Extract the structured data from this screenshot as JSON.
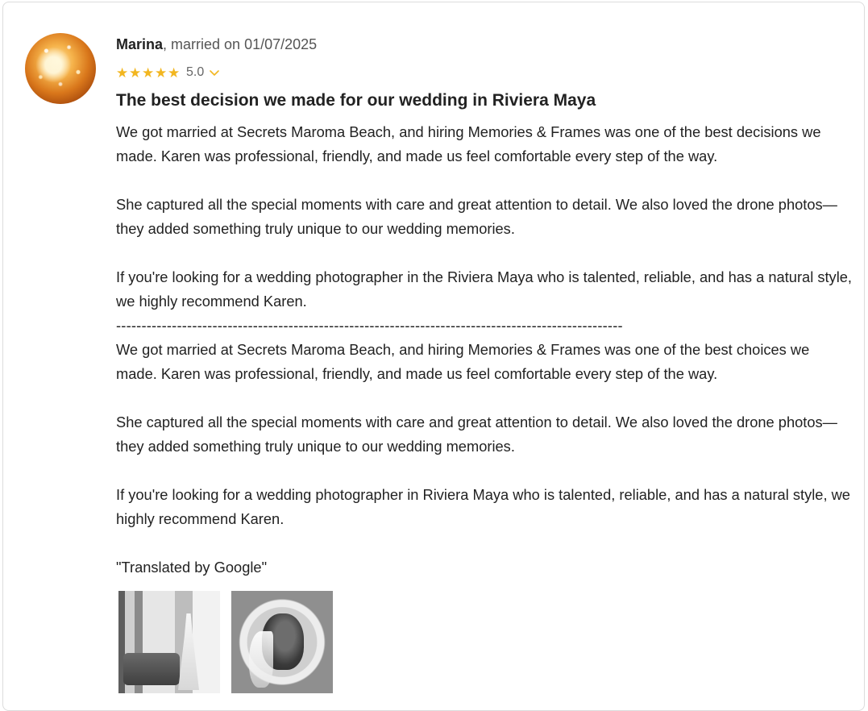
{
  "review": {
    "author": "Marina",
    "married_text": ", married on 01/07/2025",
    "rating": "5.0",
    "rating_stars": 5,
    "title": "The best decision we made for our wedding in Riviera Maya",
    "paragraphs": [
      "We got married at Secrets Maroma Beach, and hiring Memories & Frames was one of the best decisions we made. Karen was professional, friendly, and made us feel comfortable every step of the way.",
      "She captured all the special moments with care and great attention to detail. We also loved the drone photos—they added something truly unique to our wedding memories.",
      "If you're looking for a wedding photographer in the Riviera Maya who is talented, reliable, and has a natural style, we highly recommend Karen."
    ],
    "divider": "----------------------------------------------------------------------------------------------------",
    "translated_paragraphs": [
      "We got married at Secrets Maroma Beach, and hiring Memories & Frames was one of the best choices we made. Karen was professional, friendly, and made us feel comfortable every step of the way.",
      "She captured all the special moments with care and great attention to detail. We also loved the drone photos—they added something truly unique to our wedding memories.",
      "If you're looking for a wedding photographer in Riviera Maya who is talented, reliable, and has a natural style, we highly recommend Karen."
    ],
    "translated_note": "\"Translated by Google\""
  },
  "icons": {
    "star": "star-icon",
    "chevron": "chevron-down-icon"
  },
  "colors": {
    "star": "#f2b620",
    "text": "#222222",
    "muted": "#555555"
  }
}
